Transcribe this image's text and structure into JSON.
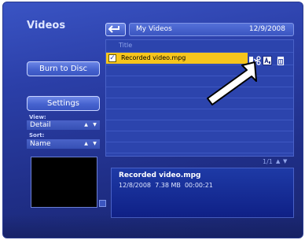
{
  "header": {
    "title": "Videos"
  },
  "sidebar": {
    "burn_label": "Burn to Disc",
    "settings_label": "Settings",
    "view_label": "View:",
    "view_value": "Detail",
    "sort_label": "Sort:",
    "sort_value": "Name"
  },
  "location": {
    "name": "My Videos",
    "date": "12/9/2008"
  },
  "list": {
    "column_title": "Title",
    "rows": [
      {
        "label": "Recorded video.mpg",
        "selected": true,
        "checked": true
      }
    ],
    "page": "1/1"
  },
  "details": {
    "title": "Recorded video.mpg",
    "date": "12/8/2008",
    "size": "7.38 MB",
    "duration": "00:00:21"
  },
  "icons": {
    "back": "back-arrow-icon",
    "cut": "scissors-icon",
    "rename": "rename-icon",
    "delete": "trash-icon",
    "pointer": "callout-arrow-icon"
  },
  "colors": {
    "accent": "#f6c51d",
    "background": "#2b3fa8"
  }
}
